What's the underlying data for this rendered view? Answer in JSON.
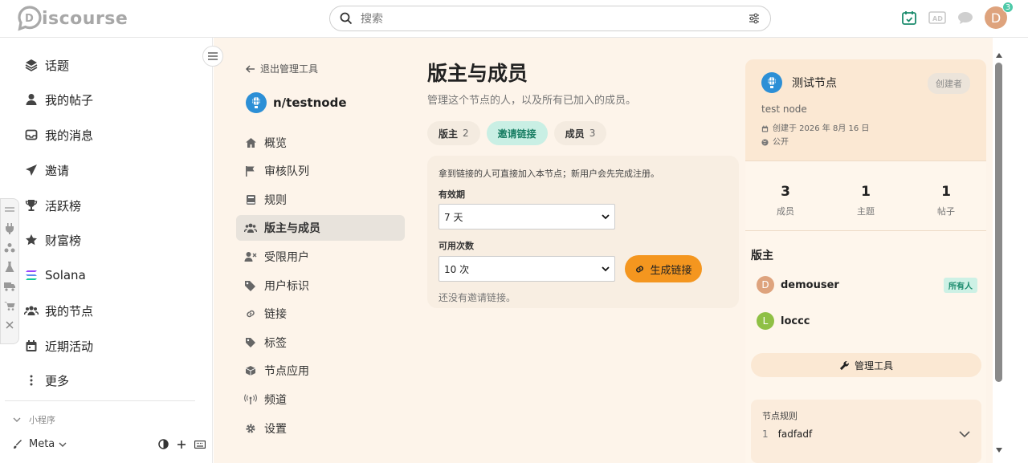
{
  "header": {
    "logo_text": "iscourse",
    "search_placeholder": "搜索",
    "notification_count": "3",
    "avatar_letter": "D"
  },
  "sidebar": {
    "items": [
      {
        "label": "话题",
        "icon": "layers-icon"
      },
      {
        "label": "我的帖子",
        "icon": "user-icon"
      },
      {
        "label": "我的消息",
        "icon": "inbox-icon"
      },
      {
        "label": "邀请",
        "icon": "paper-plane-icon"
      },
      {
        "label": "活跃榜",
        "icon": "trophy-icon"
      },
      {
        "label": "财富榜",
        "icon": "star-icon"
      },
      {
        "label": "Solana",
        "icon": "solana-icon"
      },
      {
        "label": "我的节点",
        "icon": "users-icon"
      },
      {
        "label": "近期活动",
        "icon": "calendar-icon"
      },
      {
        "label": "更多",
        "icon": "vertical-dots-icon"
      }
    ],
    "section_label": "小程序",
    "meta_label": "Meta"
  },
  "admin_nav": {
    "back_label": "退出管理工具",
    "node_name": "n/testnode",
    "items": [
      {
        "label": "概览",
        "icon": "home-icon",
        "active": false
      },
      {
        "label": "审核队列",
        "icon": "flag-icon",
        "active": false
      },
      {
        "label": "规则",
        "icon": "book-icon",
        "active": false
      },
      {
        "label": "版主与成员",
        "icon": "users-icon",
        "active": true
      },
      {
        "label": "受限用户",
        "icon": "user-x-icon",
        "active": false
      },
      {
        "label": "用户标识",
        "icon": "tags-icon",
        "active": false
      },
      {
        "label": "链接",
        "icon": "link-icon",
        "active": false
      },
      {
        "label": "标签",
        "icon": "tag-icon",
        "active": false
      },
      {
        "label": "节点应用",
        "icon": "cube-icon",
        "active": false
      },
      {
        "label": "频道",
        "icon": "broadcast-icon",
        "active": false
      },
      {
        "label": "设置",
        "icon": "gear-icon",
        "active": false
      }
    ]
  },
  "content": {
    "title": "版主与成员",
    "subtitle": "管理这个节点的人，以及所有已加入的成员。",
    "tabs": [
      {
        "label": "版主",
        "count": "2",
        "active": false
      },
      {
        "label": "邀请链接",
        "count": "",
        "active": true
      },
      {
        "label": "成员",
        "count": "3",
        "active": false
      }
    ],
    "invite": {
      "note": "拿到链接的人可直接加入本节点；新用户会先完成注册。",
      "expiry_label": "有效期",
      "expiry_value": "7 天",
      "uses_label": "可用次数",
      "uses_value": "10 次",
      "generate_label": "生成链接",
      "empty_note": "还没有邀请链接。"
    }
  },
  "info_panel": {
    "node_title": "测试节点",
    "creator_badge": "创建者",
    "description": "test node",
    "created": "创建于 2026 年 8月 16 日",
    "visibility": "公开",
    "stats": [
      {
        "value": "3",
        "label": "成员"
      },
      {
        "value": "1",
        "label": "主题"
      },
      {
        "value": "1",
        "label": "帖子"
      }
    ],
    "mods_title": "版主",
    "moderators": [
      {
        "name": "demouser",
        "letter": "D",
        "color": "#dea37d",
        "badge": "所有人"
      },
      {
        "name": "loccc",
        "letter": "L",
        "color": "#8fc045",
        "badge": ""
      }
    ],
    "tools_label": "管理工具",
    "rules_title": "节点规则",
    "rules": [
      {
        "num": "1",
        "text": "fadfadf"
      }
    ]
  },
  "colors": {
    "accent_orange": "#f4961f",
    "accent_teal": "#177d62",
    "page_bg": "#fdf4ea"
  }
}
